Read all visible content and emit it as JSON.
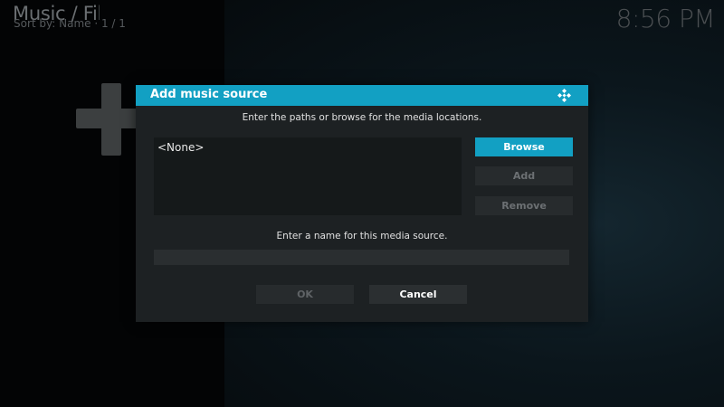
{
  "header": {
    "title": "Music / Files",
    "sort_info": "Sort by: Name  ·  1 / 1",
    "clock": "8:56 PM"
  },
  "background": {
    "add_icon": "plus-icon"
  },
  "dialog": {
    "title": "Add music source",
    "logo_icon": "kodi-logo-icon",
    "paths_instruction": "Enter the paths or browse for the media locations.",
    "paths": [
      "<None>"
    ],
    "buttons": {
      "browse": "Browse",
      "add": "Add",
      "remove": "Remove"
    },
    "name_instruction": "Enter a name for this media source.",
    "name_value": "",
    "ok": "OK",
    "cancel": "Cancel"
  },
  "colors": {
    "accent": "#12a0c3",
    "dialog_bg": "#1d2123",
    "button_bg": "#272b2d"
  }
}
